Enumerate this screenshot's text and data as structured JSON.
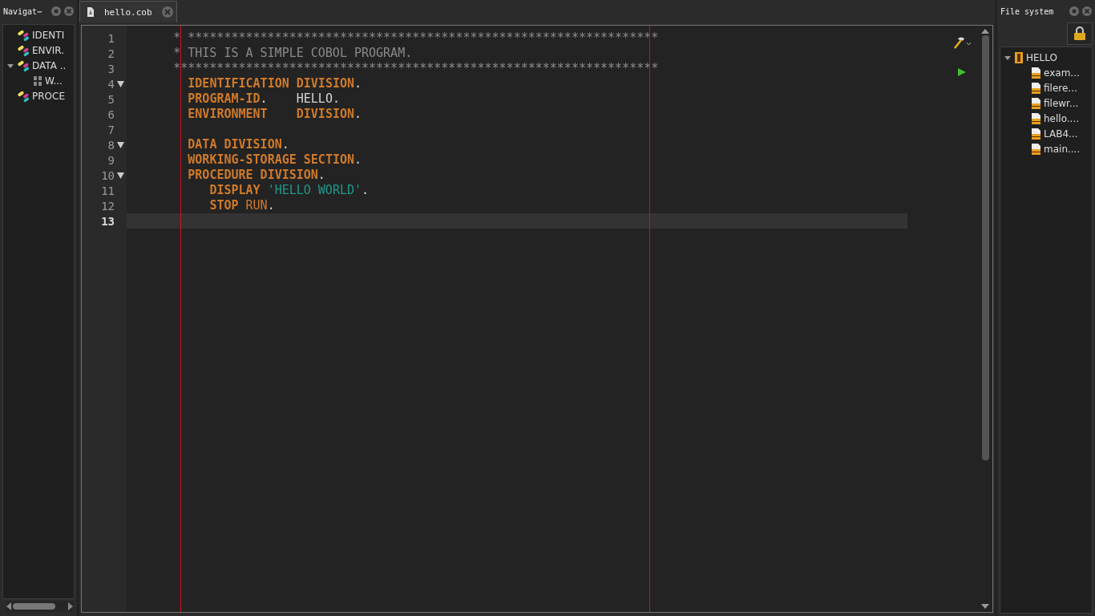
{
  "navigator": {
    "title": "Navigat⋯",
    "items": [
      {
        "label": "IDENTI",
        "kind": "division"
      },
      {
        "label": "ENVIR.",
        "kind": "division"
      },
      {
        "label": "DATA ..",
        "kind": "division",
        "expanded": true,
        "children": [
          {
            "label": "W...",
            "kind": "section"
          }
        ]
      },
      {
        "label": "PROCE",
        "kind": "division"
      }
    ]
  },
  "editor": {
    "tabs": [
      {
        "label": "hello.cob",
        "selected": true
      }
    ],
    "lines": [
      {
        "number": "1",
        "kind": "comment",
        "tokens": [
          {
            "kind": "comment",
            "text": "* *****************************************************************"
          }
        ]
      },
      {
        "number": "2",
        "kind": "comment",
        "tokens": [
          {
            "kind": "comment",
            "text": "* THIS IS A SIMPLE COBOL PROGRAM."
          }
        ]
      },
      {
        "number": "3",
        "kind": "comment",
        "tokens": [
          {
            "kind": "comment",
            "text": "*******************************************************************"
          }
        ]
      },
      {
        "number": "4",
        "kind": "header",
        "foldable": true,
        "tokens": [
          {
            "kind": "keyword",
            "text": "IDENTIFICATION DIVISION"
          },
          {
            "kind": "plain",
            "text": "."
          }
        ]
      },
      {
        "number": "5",
        "kind": "header",
        "tokens": [
          {
            "kind": "keyword",
            "text": "PROGRAM-ID"
          },
          {
            "kind": "plain",
            "text": ".    HELLO."
          }
        ]
      },
      {
        "number": "6",
        "kind": "header",
        "tokens": [
          {
            "kind": "keyword",
            "text": "ENVIRONMENT    DIVISION"
          },
          {
            "kind": "plain",
            "text": "."
          }
        ]
      },
      {
        "number": "7"
      },
      {
        "number": "8",
        "kind": "header",
        "foldable": true,
        "tokens": [
          {
            "kind": "keyword",
            "text": "DATA DIVISION"
          },
          {
            "kind": "plain",
            "text": "."
          }
        ]
      },
      {
        "number": "9",
        "kind": "header",
        "tokens": [
          {
            "kind": "keyword",
            "text": "WORKING-STORAGE SECTION"
          },
          {
            "kind": "plain",
            "text": "."
          }
        ]
      },
      {
        "number": "10",
        "kind": "header",
        "foldable": true,
        "tokens": [
          {
            "kind": "keyword",
            "text": "PROCEDURE DIVISION"
          },
          {
            "kind": "plain",
            "text": "."
          }
        ]
      },
      {
        "number": "11",
        "kind": "statement",
        "tokens": [
          {
            "kind": "keyword",
            "text": "DISPLAY"
          },
          {
            "kind": "string",
            "text": "'HELLO WORLD'"
          },
          {
            "kind": "plain",
            "text": "."
          }
        ]
      },
      {
        "number": "12",
        "kind": "statement",
        "tokens": [
          {
            "kind": "keyword",
            "text": "STOP"
          },
          {
            "kind": "builtin",
            "text": "RUN"
          },
          {
            "kind": "plain",
            "text": "."
          }
        ]
      },
      {
        "number": "13",
        "current": true
      }
    ]
  },
  "file_system": {
    "title": "File system",
    "items": [
      {
        "label": "HELLO",
        "kind": "project",
        "expanded": true,
        "children": [
          {
            "label": "exam...",
            "kind": "file"
          },
          {
            "label": "filere...",
            "kind": "file"
          },
          {
            "label": "filewr...",
            "kind": "file"
          },
          {
            "label": "hello....",
            "kind": "file"
          },
          {
            "label": "LAB4...",
            "kind": "file"
          },
          {
            "label": "main....",
            "kind": "file"
          }
        ]
      }
    ]
  }
}
